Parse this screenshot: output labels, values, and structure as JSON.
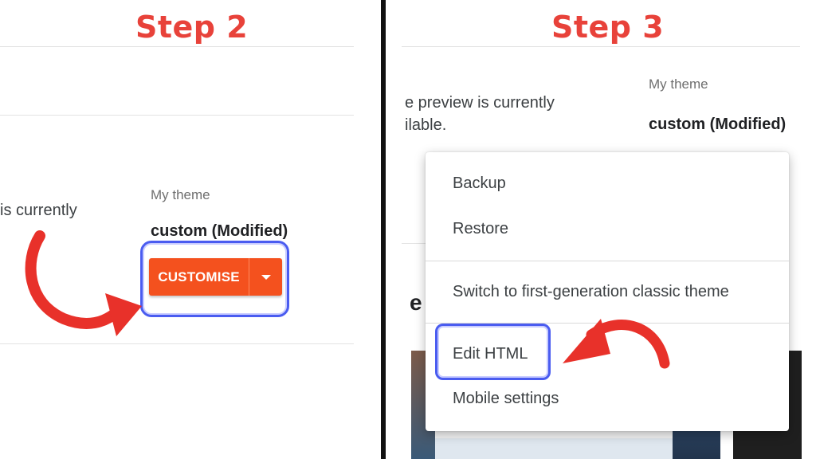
{
  "left": {
    "step_title": "Step 2",
    "preview_text": "is currently",
    "my_theme_label": "My theme",
    "theme_name": "custom (Modified)",
    "customise_label": "CUSTOMISE"
  },
  "right": {
    "step_title": "Step 3",
    "preview_line1": "e preview is currently",
    "preview_line2": "ilable.",
    "my_theme_label": "My theme",
    "theme_name": "custom (Modified)",
    "partial_heading": "e",
    "menu": {
      "backup": "Backup",
      "restore": "Restore",
      "switch_classic": "Switch to first-generation classic theme",
      "edit_html": "Edit HTML",
      "mobile_settings": "Mobile settings"
    }
  },
  "colors": {
    "accent_red": "#e8423a",
    "button_orange": "#f4511e",
    "highlight_blue": "#4a5cf0"
  }
}
